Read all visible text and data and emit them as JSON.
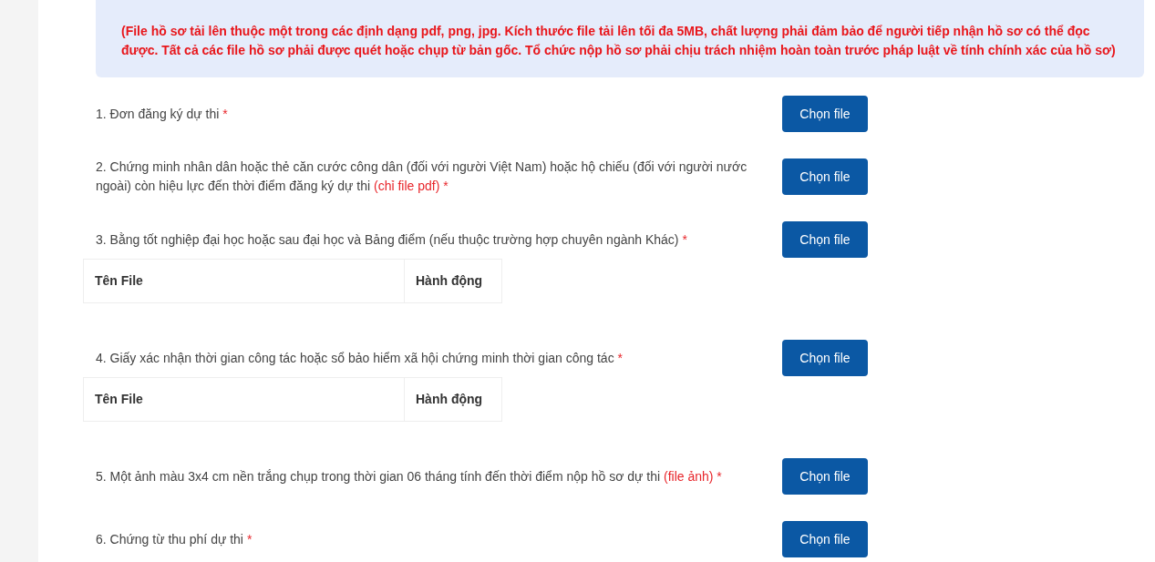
{
  "notice": "(File hồ sơ tải lên thuộc một trong các định dạng pdf, png, jpg. Kích thước file tải lên tối đa 5MB, chất lượng phải đảm bảo để người tiếp nhận hồ sơ có thể đọc được. Tất cả các file hồ sơ phải được quét hoặc chụp từ bản gốc. Tổ chức nộp hồ sơ phải chịu trách nhiệm hoàn toàn trước pháp luật về tính chính xác của hồ sơ)",
  "items": [
    {
      "label": "1. Đơn đăng ký dự thi",
      "mark": "*",
      "button": "Chọn file"
    },
    {
      "label": "2. Chứng minh nhân dân hoặc thẻ căn cước công dân (đối với người Việt Nam) hoặc hộ chiếu (đối với người nước ngoài) còn hiệu lực đến thời điểm đăng ký dự thi",
      "note": "(chỉ file pdf)",
      "mark": "*",
      "button": "Chọn file"
    },
    {
      "label": "3. Bằng tốt nghiệp đại học hoặc sau đại học và Bảng điểm (nếu thuộc trường hợp chuyên ngành Khác)",
      "mark": "*",
      "button": "Chọn file",
      "table": {
        "columns": [
          "Tên File",
          "Hành động"
        ]
      }
    },
    {
      "label": "4. Giấy xác nhận thời gian công tác hoặc sổ bảo hiểm xã hội chứng minh thời gian công tác",
      "mark": "*",
      "button": "Chọn file",
      "table": {
        "columns": [
          "Tên File",
          "Hành động"
        ]
      }
    },
    {
      "label": "5. Một ảnh màu 3x4 cm nền trắng chụp trong thời gian 06 tháng tính đến thời điểm nộp hồ sơ dự thi",
      "note": "(file ảnh)",
      "mark": "*",
      "button": "Chọn file"
    },
    {
      "label": "6. Chứng từ thu phí dự thi",
      "mark": "*",
      "button": "Chọn file"
    }
  ]
}
